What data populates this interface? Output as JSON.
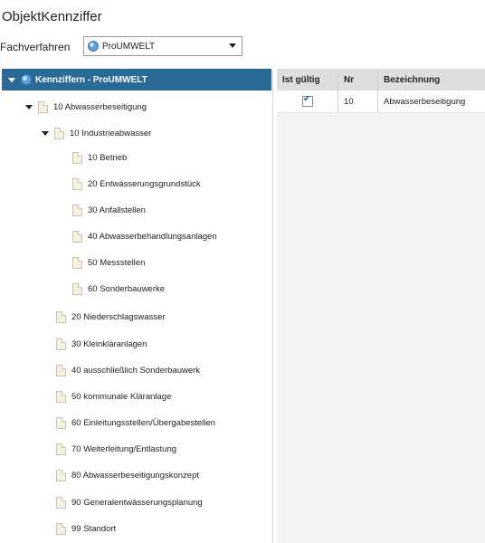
{
  "window": {
    "title": "ObjektKennziffer"
  },
  "filter": {
    "label": "Fachverfahren",
    "selected": "ProUMWELT"
  },
  "tree": {
    "root_label": "Kennziffern - ProUMWELT",
    "items": [
      {
        "label": "10 Abwasserbeseitigung",
        "level": 1,
        "expanded": true
      },
      {
        "label": "10 Industrieabwasser",
        "level": 2,
        "expanded": true
      },
      {
        "label": "10 Betrieb",
        "level": 3
      },
      {
        "label": "20 Entwässerungsgrundstück",
        "level": 3
      },
      {
        "label": "30 Anfallstellen",
        "level": 3
      },
      {
        "label": "40 Abwasserbehandlungsanlagen",
        "level": 3
      },
      {
        "label": "50 Messstellen",
        "level": 3
      },
      {
        "label": "60 Sonderbauwerke",
        "level": 3
      },
      {
        "label": "20 Niederschlagswasser",
        "level": 2
      },
      {
        "label": "30 Kleinkläranlagen",
        "level": 2
      },
      {
        "label": "40 ausschließlich Sonderbauwerk",
        "level": 2
      },
      {
        "label": "50 kommunale Kläranlage",
        "level": 2
      },
      {
        "label": "60 Einleitungsstellen/Übergabestellen",
        "level": 2
      },
      {
        "label": "70 Weiterleitung/Entlastung",
        "level": 2
      },
      {
        "label": "80 Abwasserbeseitigungskonzept",
        "level": 2
      },
      {
        "label": "90 Generalentwässerungsplanung",
        "level": 2
      },
      {
        "label": "99 Standort",
        "level": 2
      }
    ]
  },
  "grid": {
    "columns": [
      "Ist gültig",
      "Nr",
      "Bezeichnung"
    ],
    "rows": [
      {
        "ist_gueltig": true,
        "nr": "10",
        "bezeichnung": "Abwasserbeseitigung"
      }
    ]
  },
  "colors": {
    "selection": "#2b6a96",
    "header": "#dedede"
  }
}
